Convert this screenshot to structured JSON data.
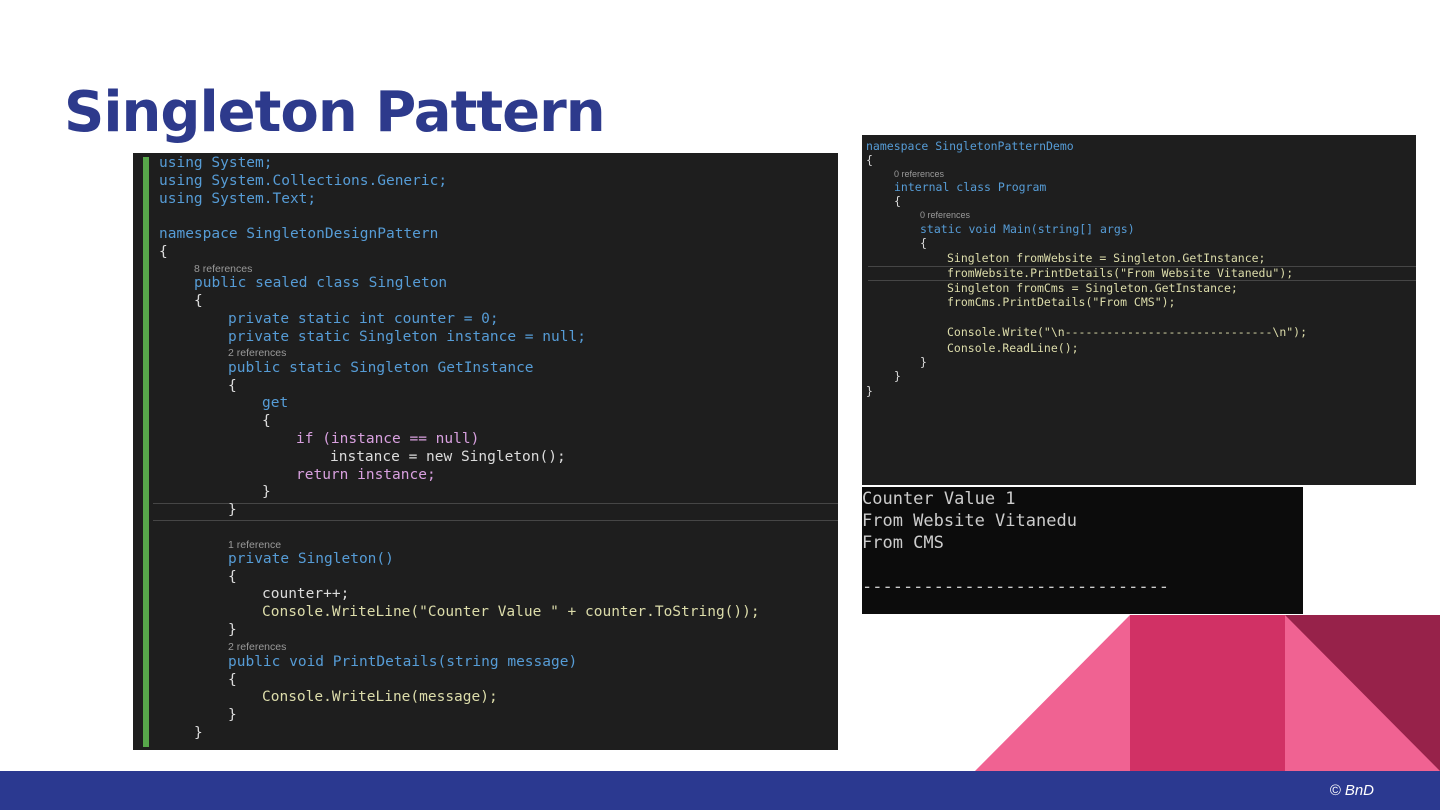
{
  "slide": {
    "title": "Singleton Pattern",
    "copyright": "© BnD",
    "colors": {
      "title": "#2d3a8c",
      "footer": "#2b3990",
      "accent_pink": "#f06292",
      "accent_magenta": "#d13165",
      "accent_maroon": "#97224a"
    }
  },
  "left_code": {
    "lines": [
      "using System;",
      "using System.Collections.Generic;",
      "using System.Text;",
      "",
      "namespace SingletonDesignPattern",
      "{",
      "8 references",
      "public sealed class Singleton",
      "{",
      "private static int counter = 0;",
      "private static Singleton instance = null;",
      "2 references",
      "public static Singleton GetInstance",
      "{",
      "get",
      "{",
      "if (instance == null)",
      "instance = new Singleton();",
      "return instance;",
      "}",
      "}",
      "1 reference",
      "private Singleton()",
      "{",
      "counter++;",
      "Console.WriteLine(\"Counter Value \" + counter.ToString());",
      "}",
      "2 references",
      "public void PrintDetails(string message)",
      "{",
      "Console.WriteLine(message);",
      "}",
      "}"
    ]
  },
  "right_code": {
    "lines": [
      "namespace SingletonPatternDemo",
      "{",
      "0 references",
      "internal class Program",
      "{",
      "0 references",
      "static void Main(string[] args)",
      "{",
      "Singleton fromWebsite = Singleton.GetInstance;",
      "fromWebsite.PrintDetails(\"From Website Vitanedu\");",
      "Singleton fromCms = Singleton.GetInstance;",
      "fromCms.PrintDetails(\"From CMS\");",
      "Console.Write(\"\\n------------------------------\\n\");",
      "Console.ReadLine();",
      "}",
      "}",
      "}"
    ]
  },
  "console_output": {
    "lines": [
      "Counter Value 1",
      "From Website Vitanedu",
      "From CMS",
      "------------------------------"
    ]
  }
}
